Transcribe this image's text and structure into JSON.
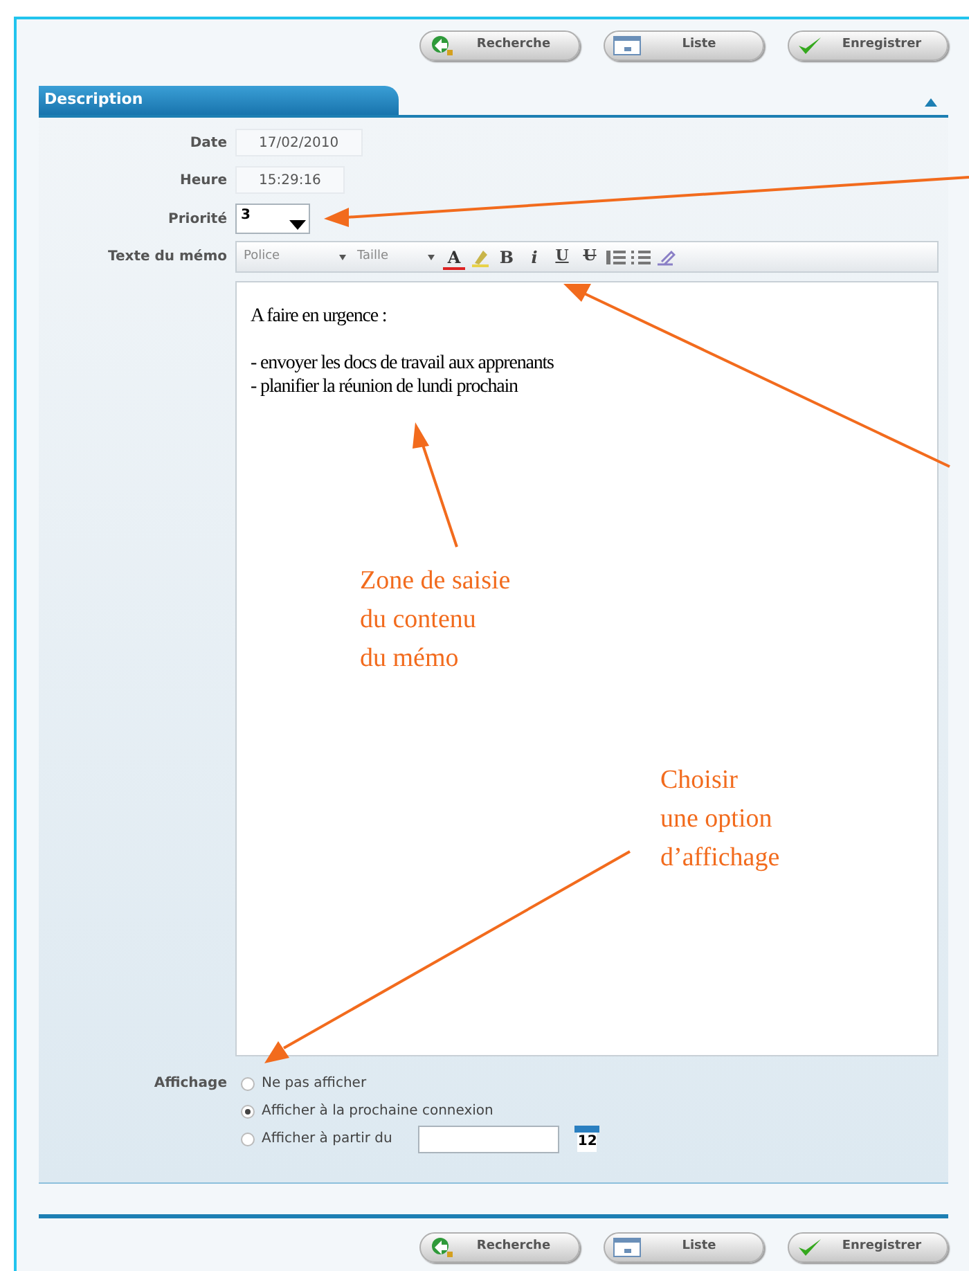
{
  "toolbar_top": [
    {
      "label": "Recherche",
      "kind": "search"
    },
    {
      "label": "Liste",
      "kind": "list"
    },
    {
      "label": "Enregistrer",
      "kind": "save"
    }
  ],
  "section": {
    "title": "Description"
  },
  "fields": [
    {
      "label": "Date",
      "value": "17/02/2010"
    },
    {
      "label": "Heure",
      "value": "15:29:16"
    }
  ],
  "priority": {
    "label": "Priorité",
    "value": "3"
  },
  "memo": {
    "label": "Texte du mémo",
    "font_select": "Police",
    "size_select": "Taille",
    "tools": [
      {
        "kind": "color",
        "glyph": "A"
      },
      {
        "kind": "highlight"
      },
      {
        "kind": "bold",
        "glyph": "B"
      },
      {
        "kind": "italic",
        "glyph": "i"
      },
      {
        "kind": "underline",
        "glyph": "U"
      },
      {
        "kind": "strike",
        "glyph": "U"
      },
      {
        "kind": "ol"
      },
      {
        "kind": "ul"
      },
      {
        "kind": "clean"
      }
    ],
    "paragraphs": [
      [
        "A faire en urgence :"
      ],
      [
        "- envoyer les docs de travail aux apprenants",
        "- planifier la réunion de lundi prochain"
      ]
    ]
  },
  "display": {
    "label": "Affichage",
    "options": [
      {
        "label": "Ne pas afficher",
        "selected": false
      },
      {
        "label": "Afficher à la prochaine connexion",
        "selected": true
      },
      {
        "label": "Afficher à partir du",
        "selected": false,
        "kind": "date"
      }
    ],
    "calendar_day": "12"
  },
  "toolbar_bottom": [
    {
      "label": "Recherche",
      "kind": "search"
    },
    {
      "label": "Liste",
      "kind": "list"
    },
    {
      "label": "Enregistrer",
      "kind": "save"
    }
  ],
  "annotations": [
    {
      "lines": [
        "Zone de saisie",
        "du contenu",
        "du mémo"
      ]
    },
    {
      "lines": [
        "Choisir",
        "une option",
        "d’affichage"
      ]
    }
  ]
}
